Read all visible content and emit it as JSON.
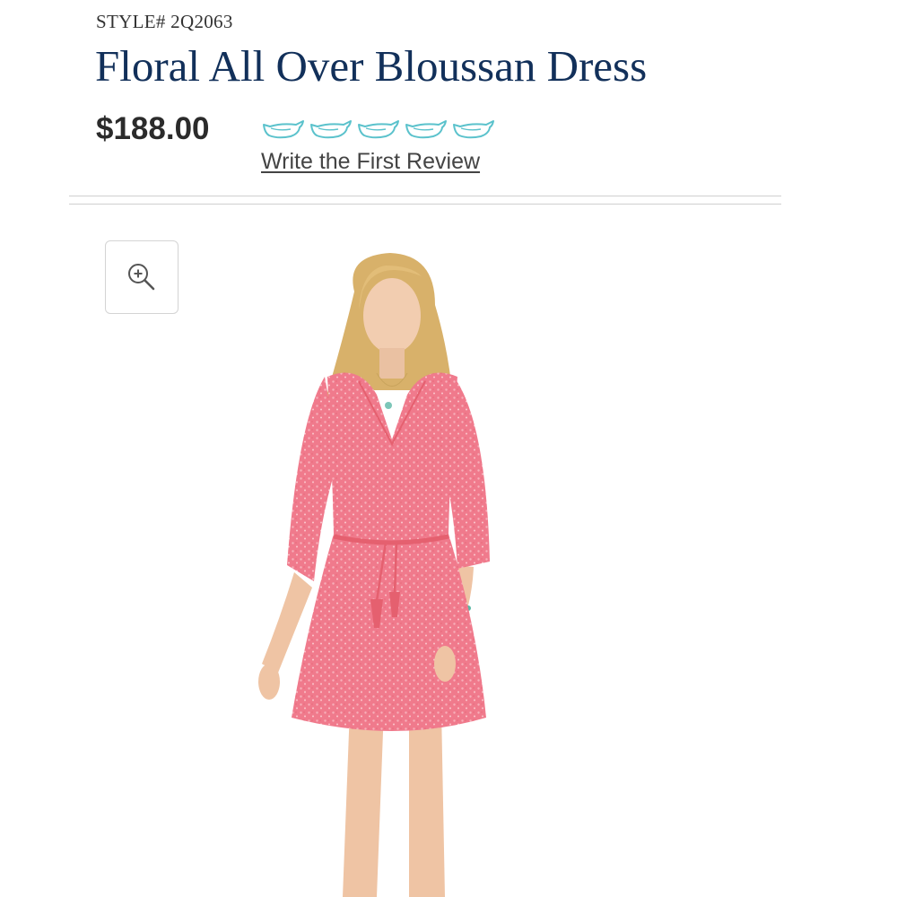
{
  "product": {
    "style_number": "STYLE# 2Q2063",
    "title": "Floral All Over Bloussan Dress",
    "price": "$188.00",
    "rating": {
      "icon": "whale-icon",
      "count": 5,
      "filled": 0,
      "outline_color": "#5bc2cc"
    },
    "review_link": "Write the First Review"
  },
  "toolbar": {
    "zoom_icon": "zoom-in-icon"
  },
  "colors": {
    "title": "#12305a",
    "price": "#2b2b2b",
    "divider": "#cfcfcf",
    "dress": "#f07a8c"
  }
}
